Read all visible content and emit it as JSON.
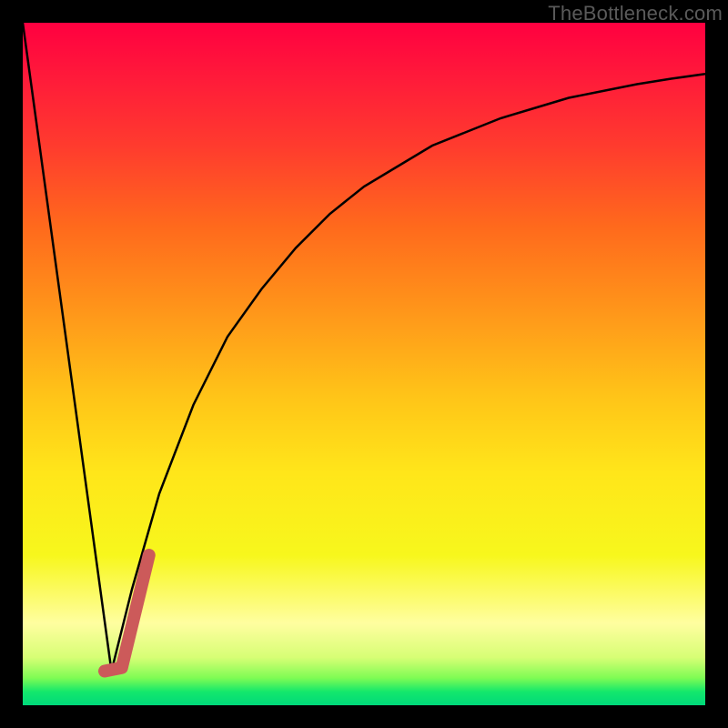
{
  "watermark": "TheBottleneck.com",
  "chart_data": {
    "type": "line",
    "title": "",
    "xlabel": "",
    "ylabel": "",
    "xlim": [
      0,
      100
    ],
    "ylim": [
      0,
      100
    ],
    "grid": false,
    "series": [
      {
        "name": "left-descending-line",
        "stroke": "#000000",
        "width": 2.5,
        "x": [
          0,
          13
        ],
        "y": [
          100,
          5
        ]
      },
      {
        "name": "right-rising-curve",
        "stroke": "#000000",
        "width": 2.5,
        "x": [
          13,
          16,
          20,
          25,
          30,
          35,
          40,
          45,
          50,
          55,
          60,
          65,
          70,
          75,
          80,
          85,
          90,
          95,
          100
        ],
        "y": [
          5,
          17,
          31,
          44,
          54,
          61,
          67,
          72,
          76,
          79,
          82,
          84,
          86,
          87.5,
          89,
          90,
          91,
          91.8,
          92.5
        ]
      },
      {
        "name": "highlight-stub",
        "stroke": "#cc5a5a",
        "width": 10,
        "linecap": "round",
        "x": [
          12,
          14.5,
          18.5
        ],
        "y": [
          5,
          5.5,
          22
        ]
      }
    ]
  }
}
